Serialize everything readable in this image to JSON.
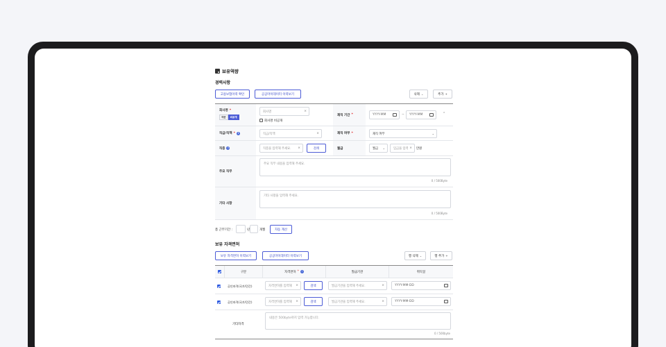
{
  "page_title": "보유역량",
  "career": {
    "title": "경력사항",
    "btn_insurance": "고용보험이력 확인",
    "btn_public": "공공마이데이터 이력보기",
    "btn_delete": "삭제",
    "btn_add": "추가",
    "company_label": "회사명",
    "company_toggle": [
      "국문",
      "비공개"
    ],
    "company_placeholder": "회사명",
    "company_private": "회사명 비공개",
    "period_label": "재직 기간",
    "period_from": "YYYY-MM",
    "period_sep": "~",
    "period_to": "YYYY-MM",
    "position_label": "직급/직책",
    "position_placeholder": "직급/직책",
    "status_label": "재직 여부",
    "status_value": "재직 여부",
    "job_label": "직종",
    "job_placeholder": "직종을 입력해 주세요.",
    "job_search": "검색",
    "salary_label": "월급",
    "salary_type": "월급",
    "salary_placeholder": "임금을 입력",
    "salary_unit": "만원",
    "duty_label": "주요 직무",
    "duty_placeholder": "주요 직무 내용을 입력해 주세요.",
    "duty_counter": "0 / 500Byte",
    "etc_label": "기타 사항",
    "etc_placeholder": "기타 사항을 입력해 주세요.",
    "etc_counter": "0 / 500Byte",
    "total_label": "총 근무기간 :",
    "total_year_unit": "년",
    "total_month_unit": "개월",
    "auto_calc": "자동 계산"
  },
  "cert": {
    "title": "보유 자격면허",
    "btn_mine": "보유 자격면허 이력보기",
    "btn_public": "공공마이데이터 이력보기",
    "btn_row_delete": "행 삭제",
    "btn_row_add": "행 추가",
    "columns": [
      "구분",
      "자격면허",
      "발급기관",
      "취득일"
    ],
    "rows": [
      {
        "kind": "공인자격(국가/민간)",
        "name_placeholder": "자격면허를 입력해",
        "search": "검색",
        "issuer_placeholder": "발급기관을 입력해 주세요.",
        "date": "YYYY-MM-DD"
      },
      {
        "kind": "공인자격(국가/민간)",
        "name_placeholder": "자격면허를 입력해",
        "search": "검색",
        "issuer_placeholder": "발급기관을 입력해 주세요.",
        "date": "YYYY-MM-DD"
      }
    ],
    "other_label": "기타자격",
    "other_placeholder": "내용은 500byte까지 입력 가능합니다.",
    "other_counter": "0 / 500byte"
  }
}
